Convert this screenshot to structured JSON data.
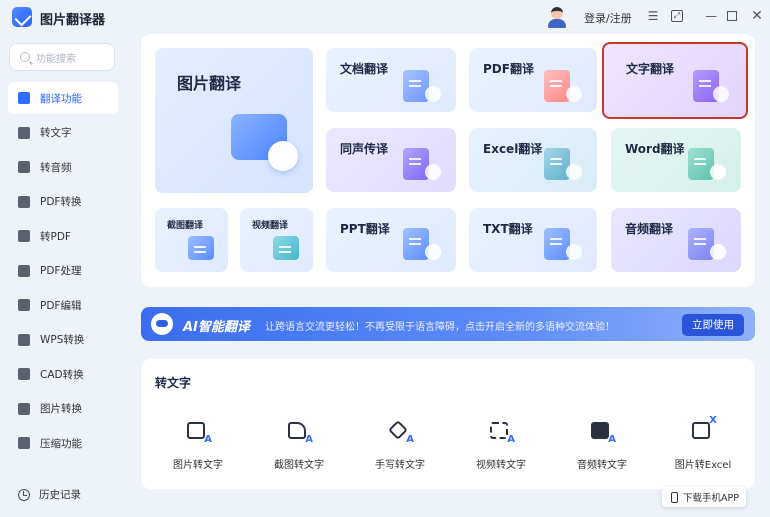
{
  "app": {
    "title": "图片翻译器"
  },
  "header": {
    "login": "登录/注册"
  },
  "sidebar": {
    "search_placeholder": "功能搜索",
    "items": [
      {
        "label": "翻译功能",
        "icon": "translate-icon",
        "active": true
      },
      {
        "label": "转文字",
        "icon": "text-icon"
      },
      {
        "label": "转音频",
        "icon": "audio-icon"
      },
      {
        "label": "PDF转换",
        "icon": "pdf-convert-icon"
      },
      {
        "label": "转PDF",
        "icon": "to-pdf-icon"
      },
      {
        "label": "PDF处理",
        "icon": "pdf-process-icon"
      },
      {
        "label": "PDF编辑",
        "icon": "pdf-edit-icon"
      },
      {
        "label": "WPS转换",
        "icon": "wps-icon"
      },
      {
        "label": "CAD转换",
        "icon": "cad-icon"
      },
      {
        "label": "图片转换",
        "icon": "image-convert-icon"
      },
      {
        "label": "压缩功能",
        "icon": "compress-icon"
      }
    ],
    "history": "历史记录"
  },
  "translate": {
    "image": "图片翻译",
    "screenshot": "截图翻译",
    "video": "视频翻译",
    "doc": "文档翻译",
    "pdf": "PDF翻译",
    "text": "文字翻译",
    "sim": "同声传译",
    "excel": "Excel翻译",
    "word": "Word翻译",
    "ppt": "PPT翻译",
    "txt": "TXT翻译",
    "audio": "音频翻译"
  },
  "ai": {
    "title": "AI智能翻译",
    "desc": "让跨语言交流更轻松！不再受限于语言障碍，点击开启全新的多语种交流体验！",
    "button": "立即使用"
  },
  "to_text": {
    "title": "转文字",
    "tools": [
      "图片转文字",
      "截图转文字",
      "手写转文字",
      "视频转文字",
      "音频转文字",
      "图片转Excel"
    ]
  },
  "download": "下载手机APP",
  "colors": {
    "accent": "#2f6bff",
    "selected_border": "#c0392b"
  }
}
